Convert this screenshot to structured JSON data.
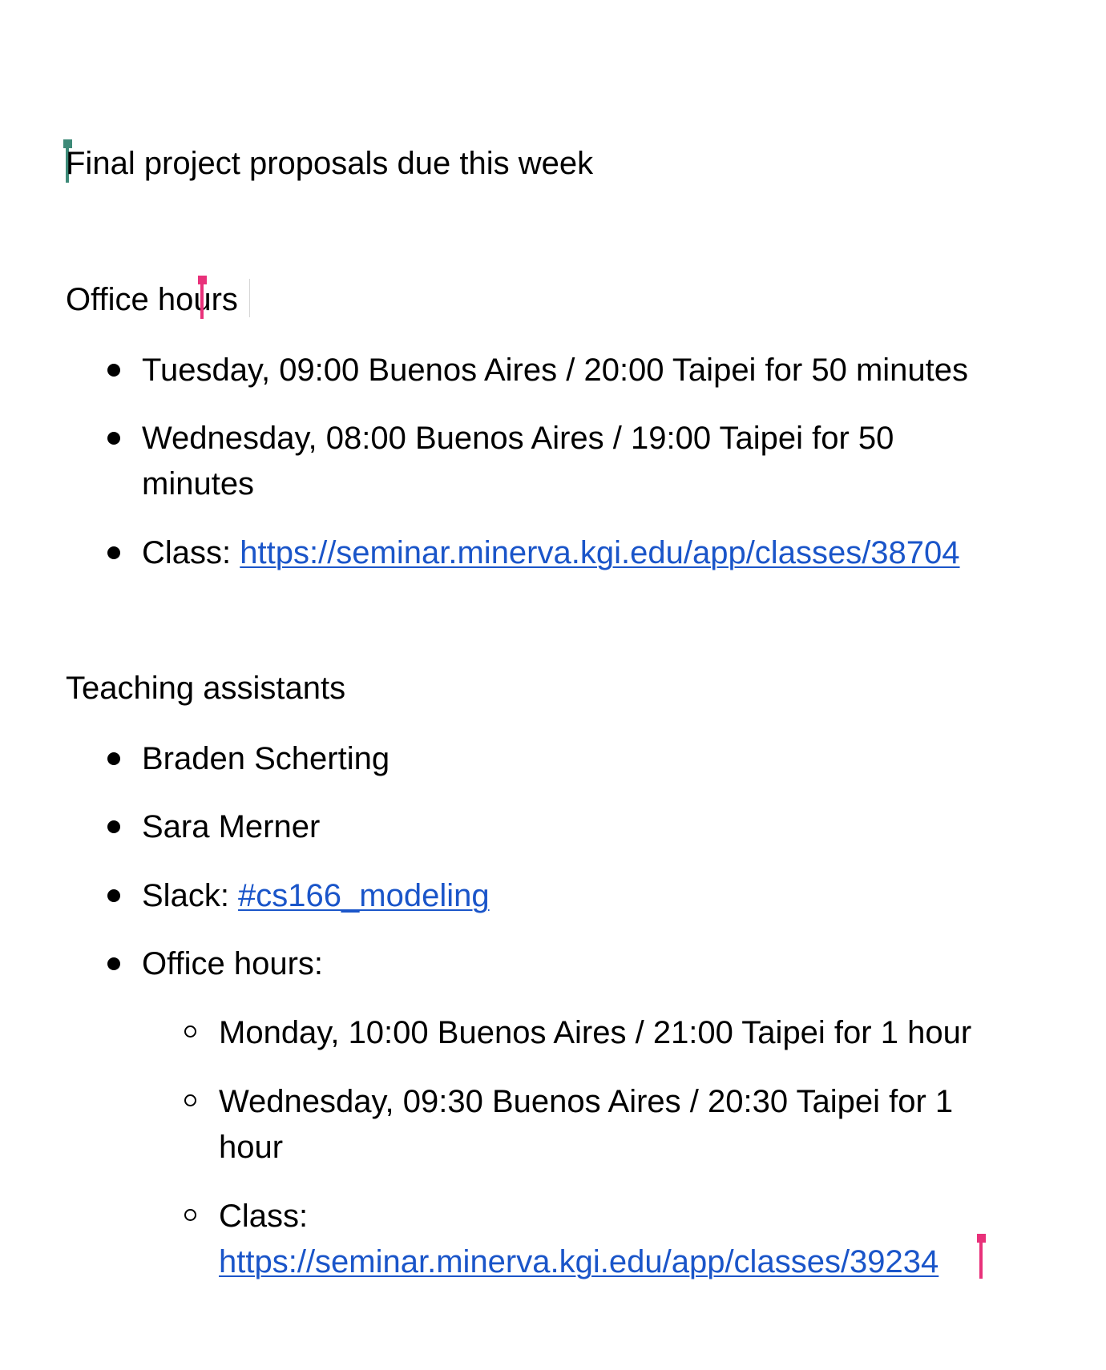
{
  "document": {
    "announcement": "Final project proposals due this week",
    "office_hours_section": {
      "heading": "Office hours",
      "items": [
        "Tuesday, 09:00 Buenos Aires / 20:00 Taipei for 50 minutes",
        {
          "line1": "Wednesday, 08:00 Buenos Aires / 19:00 Taipei for 50",
          "line2": "minutes"
        },
        {
          "label": "Class: ",
          "link": "https://seminar.minerva.kgi.edu/app/classes/38704"
        }
      ]
    },
    "ta_section": {
      "heading": "Teaching assistants",
      "items": [
        "Braden Scherting",
        "Sara Merner",
        {
          "label": "Slack: ",
          "link": "#cs166_modeling"
        },
        "Office hours:"
      ],
      "sub_items": [
        "Monday, 10:00 Buenos Aires / 21:00 Taipei for 1 hour",
        {
          "line1": "Wednesday, 09:30 Buenos Aires / 20:30 Taipei for 1",
          "line2": "hour"
        },
        {
          "label": "Class:",
          "link": "https://seminar.minerva.kgi.edu/app/classes/39234"
        }
      ]
    }
  },
  "colors": {
    "text": "#000000",
    "link": "#1a55c9",
    "cursor_teal": "#3d8a78",
    "cursor_pink": "#e8317a"
  }
}
